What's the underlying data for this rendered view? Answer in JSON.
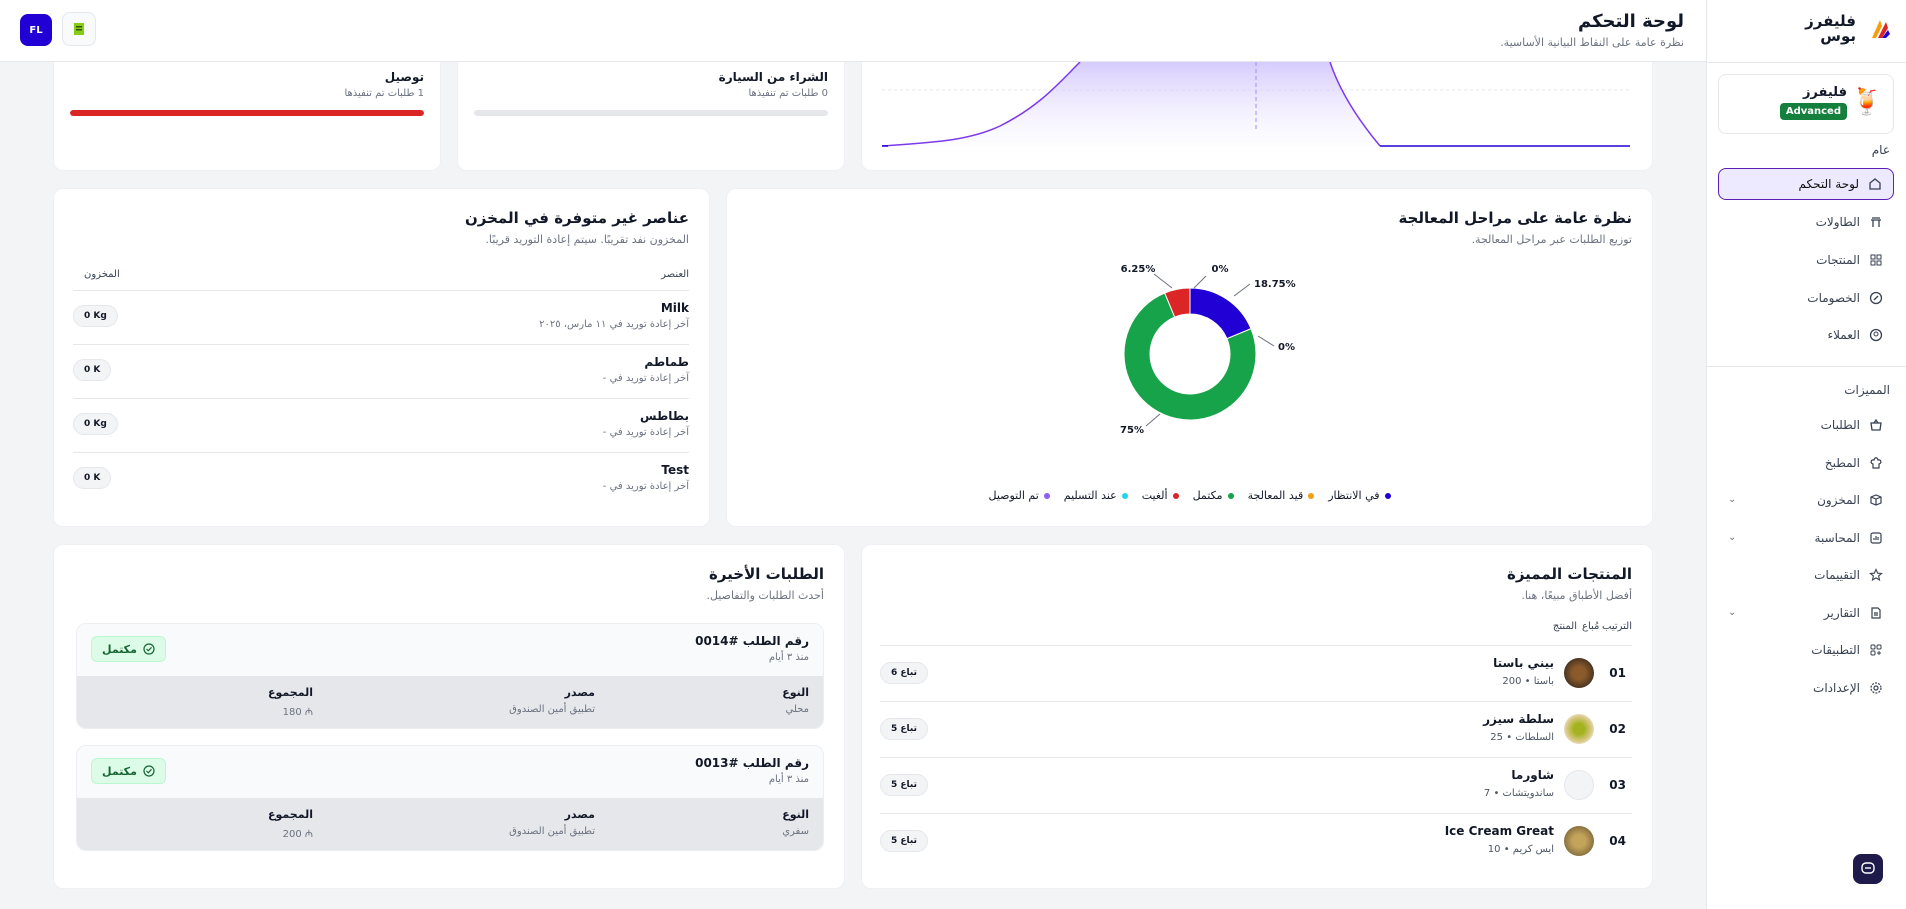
{
  "brand": {
    "name": "فليفرز بوس"
  },
  "topbar": {
    "title": "لوحة التحكم",
    "subtitle": "نظرة عامة على النقاط البيانية الأساسية.",
    "avatar_initials": "FL"
  },
  "plan": {
    "name": "فليفرز",
    "badge": "Advanced"
  },
  "sidebar": {
    "section_general": "عام",
    "general_items": [
      {
        "label": "لوحة التحكم",
        "icon": "home-icon",
        "active": true
      },
      {
        "label": "الطاولات",
        "icon": "table-icon"
      },
      {
        "label": "المنتجات",
        "icon": "grid-icon"
      },
      {
        "label": "الخصومات",
        "icon": "discount-icon"
      },
      {
        "label": "العملاء",
        "icon": "user-icon"
      }
    ],
    "section_features": "المميزات",
    "feature_items": [
      {
        "label": "الطلبات",
        "icon": "basket-icon"
      },
      {
        "label": "المطبخ",
        "icon": "chef-hat-icon"
      },
      {
        "label": "المخزون",
        "icon": "box-icon",
        "expandable": true
      },
      {
        "label": "المحاسبة",
        "icon": "accounting-icon",
        "expandable": true
      },
      {
        "label": "التقييمات",
        "icon": "star-icon"
      },
      {
        "label": "التقارير",
        "icon": "reports-icon",
        "expandable": true
      },
      {
        "label": "التطبيقات",
        "icon": "apps-icon"
      },
      {
        "label": "الإعدادات",
        "icon": "settings-icon"
      }
    ]
  },
  "metrics": [
    {
      "title": "الشراء من السيارة",
      "sub": "0 طلبات تم تنفيذها",
      "progress": 0
    },
    {
      "title": "توصيل",
      "sub": "1 طلبات تم تنفيذها",
      "progress": 1.0
    }
  ],
  "stages": {
    "title": "نظرة عامة على مراحل المعالجة",
    "subtitle": "توزيع الطلبات عبر مراحل المعالجة.",
    "chart_data": {
      "type": "pie",
      "slices": [
        {
          "label": "في الانتظار",
          "value": 18.75,
          "color": "#2000d4"
        },
        {
          "label": "قيد المعالجة",
          "value": 0,
          "color": "#f59e0b"
        },
        {
          "label": "مكتمل",
          "value": 75,
          "color": "#16a34a"
        },
        {
          "label": "ألغيت",
          "value": 6.25,
          "color": "#dc2626"
        },
        {
          "label": "عند التسليم",
          "value": 0,
          "color": "#22d3ee"
        },
        {
          "label": "تم التوصيل",
          "value": 0,
          "color": "#8b5cf6"
        }
      ],
      "data_labels": [
        "18.75%",
        "0%",
        "75%",
        "6.25%",
        "0%"
      ]
    }
  },
  "stock": {
    "title": "عناصر غير متوفرة في المخزن",
    "subtitle": "المخزون نفد تقريبًا. سيتم إعادة التوريد قريبًا.",
    "col_item": "العنصر",
    "col_stock": "المخزون",
    "rows": [
      {
        "name": "Milk",
        "date": "آخر إعادة توريد في ١١ مارس، ٢٠٢٥",
        "qty": "0 Kg"
      },
      {
        "name": "طماطم",
        "date": "آخر إعادة توريد في -",
        "qty": "0 K"
      },
      {
        "name": "بطاطس",
        "date": "آخر إعادة توريد في -",
        "qty": "0 Kg"
      },
      {
        "name": "Test",
        "date": "آخر إعادة توريد في -",
        "qty": "0 K"
      }
    ]
  },
  "featured": {
    "title": "المنتجات المميزة",
    "subtitle": "أفضل الأطباق مبيعًا، هنا.",
    "col_rank": "الترتيب",
    "col_product": "المنتج",
    "col_sold": "مُباع",
    "rows": [
      {
        "rank": "01",
        "name": "بيني باستا",
        "meta": "باستا • 200",
        "sold": "6 تباع"
      },
      {
        "rank": "02",
        "name": "سلطة سيزر",
        "meta": "السلطات • 25",
        "sold": "5 تباع"
      },
      {
        "rank": "03",
        "name": "شاورما",
        "meta": "ساندويتشات • 7",
        "sold": "5 تباع"
      },
      {
        "rank": "04",
        "name": "Ice Cream Great",
        "meta": "ايس كريم • 10",
        "sold": "5 تباع"
      }
    ]
  },
  "orders": {
    "title": "الطلبات الأخيرة",
    "subtitle": "أحدث الطلبات والتفاصيل.",
    "col_type": "النوع",
    "col_source": "مصدر",
    "col_total": "المجموع",
    "rows": [
      {
        "number": "رقم الطلب #0014",
        "time": "منذ ٣ أيام",
        "status": "مكتمل",
        "type": "محلي",
        "source": "تطبيق أمين الصندوق",
        "total": "180"
      },
      {
        "number": "رقم الطلب #0013",
        "time": "منذ ٣ أيام",
        "status": "مكتمل",
        "type": "سفري",
        "source": "تطبيق أمين الصندوق",
        "total": "200"
      }
    ]
  }
}
